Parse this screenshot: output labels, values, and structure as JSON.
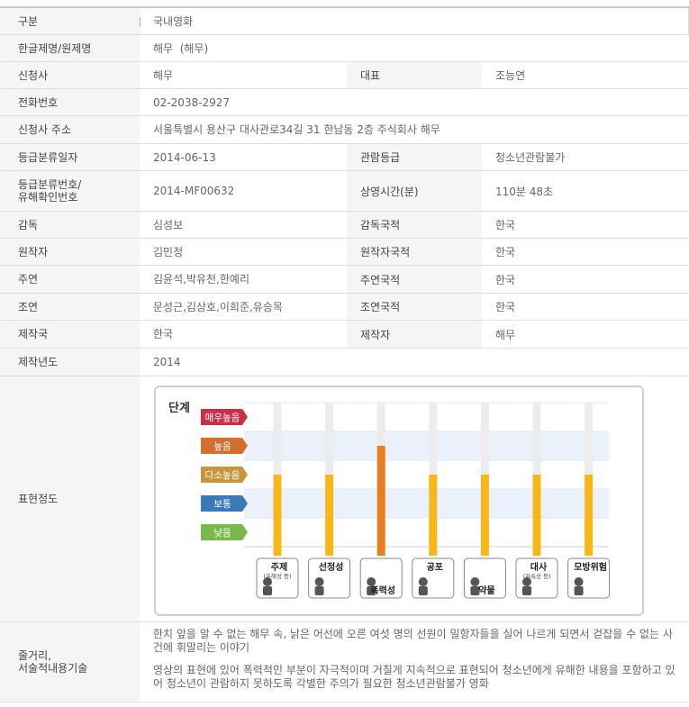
{
  "rows": {
    "category": {
      "label": "구분",
      "value": "국내영화"
    },
    "title": {
      "label": "한글제명/원제명",
      "value": "해무  (해무)"
    },
    "applicant": {
      "label": "신청사",
      "value": "해무",
      "label2": "대표",
      "value2": "조능연"
    },
    "phone": {
      "label": "전화번호",
      "value": "02-2038-2927"
    },
    "address": {
      "label": "신청사 주소",
      "value": "서울특별시 용산구 대사관로34길 31 한남동 2층 주식회사 해무"
    },
    "rating_date": {
      "label": "등급분류일자",
      "value": "2014-06-13",
      "label2": "관람등급",
      "value2": "청소년관람불가"
    },
    "rating_no": {
      "label": "등급분류번호/\n유해확인번호",
      "value": "2014-MF00632",
      "label2": "상영시간(분)",
      "value2": "110분 48초"
    },
    "director": {
      "label": "감독",
      "value": "심성보",
      "label2": "감독국적",
      "value2": "한국"
    },
    "author": {
      "label": "원작자",
      "value": "김민정",
      "label2": "원작자국적",
      "value2": "한국"
    },
    "lead": {
      "label": "주연",
      "value": "김윤석,박유천,한예리",
      "label2": "주연국적",
      "value2": "한국"
    },
    "support": {
      "label": "조연",
      "value": "문성근,김상호,이희준,유승목",
      "label2": "조연국적",
      "value2": "한국"
    },
    "country": {
      "label": "제작국",
      "value": "한국",
      "label2": "제작자",
      "value2": "해무"
    },
    "year": {
      "label": "제작년도",
      "value": "2014"
    },
    "expression": {
      "label": "표현정도"
    },
    "synopsis": {
      "label": "줄거리,\n서술적내용기술",
      "p1": "한치 앞을 알 수 없는 해무 속, 낡은 어선에 오른 여섯 명의 선원이 밀항자들을 실어 나르게 되면서 걷잡을 수 없는 사건에 휘말리는 이야기",
      "p2": "영상의 표현에 있어 폭력적인 부분이 자극적이며 거칠게 지속적으로 표현되어 청소년에게 유해한 내용을 포함하고 있어 청소년이 관람하지 못하도록 각별한 주의가 필요한 청소년관람불가 영화"
    }
  },
  "chart_data": {
    "type": "bar",
    "title": "단계",
    "levels": [
      "매우높음",
      "높음",
      "다소높음",
      "보통",
      "낮음"
    ],
    "level_colors": [
      "#c8304a",
      "#d26e2e",
      "#c8963a",
      "#3a7ab8",
      "#7ab84a"
    ],
    "categories": [
      "주제",
      "선정성",
      "폭력성",
      "공포",
      "약물",
      "대사",
      "모방위험"
    ],
    "category_sublabels": [
      "(유해성 등)",
      "",
      "",
      "",
      "",
      "(저속성 등)",
      ""
    ],
    "values": [
      3,
      3,
      4,
      3,
      3,
      3,
      3
    ],
    "value_scale": {
      "1": "낮음",
      "2": "보통",
      "3": "다소높음",
      "4": "높음",
      "5": "매우높음"
    },
    "bar_colors": {
      "normal": "#f5b818",
      "highlight": "#e97d22",
      "track": "#ececec"
    },
    "band_color": "#eaf1fa"
  }
}
